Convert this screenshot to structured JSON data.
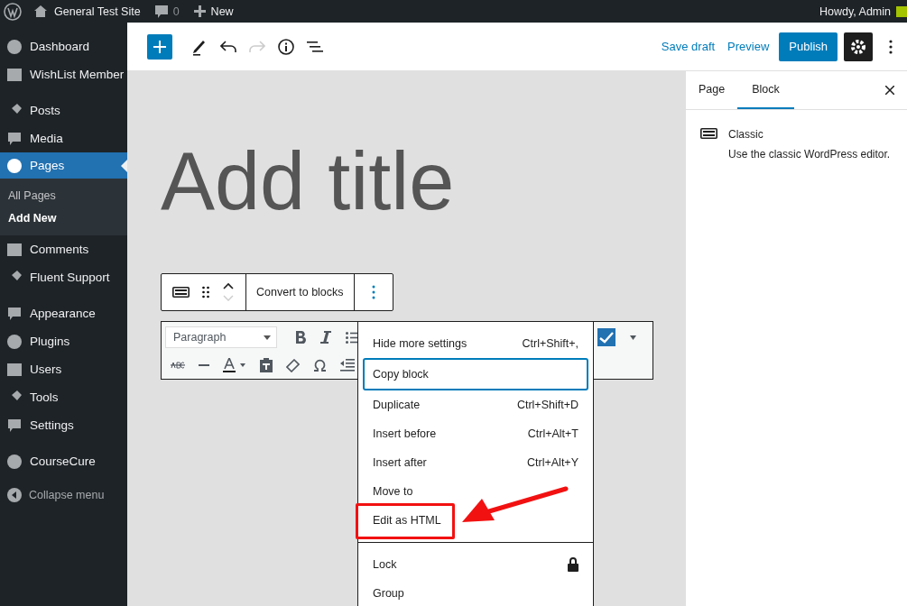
{
  "admin_bar": {
    "site_name": "General Test Site",
    "comments_count": "0",
    "new_label": "New",
    "greeting": "Howdy, Admin"
  },
  "sidebar": {
    "groups": [
      [
        {
          "label": "Dashboard",
          "selected": false
        },
        {
          "label": "WishList Member",
          "selected": false
        }
      ],
      [
        {
          "label": "Posts",
          "selected": false
        },
        {
          "label": "Media",
          "selected": false
        },
        {
          "label": "Pages",
          "selected": true,
          "children": [
            {
              "label": "All Pages",
              "selected": false
            },
            {
              "label": "Add New",
              "selected": true
            }
          ]
        },
        {
          "label": "Comments",
          "selected": false
        },
        {
          "label": "Fluent Support",
          "selected": false
        }
      ],
      [
        {
          "label": "Appearance",
          "selected": false
        },
        {
          "label": "Plugins",
          "selected": false
        },
        {
          "label": "Users",
          "selected": false
        },
        {
          "label": "Tools",
          "selected": false
        },
        {
          "label": "Settings",
          "selected": false
        }
      ],
      [
        {
          "label": "CourseCure",
          "selected": false
        }
      ]
    ],
    "collapse_label": "Collapse menu"
  },
  "header": {
    "undo": {
      "disabled": false
    },
    "redo": {
      "disabled": true
    },
    "save_draft": "Save draft",
    "preview": "Preview",
    "publish": "Publish",
    "settings_active": true
  },
  "editor": {
    "title_placeholder": "Add title",
    "block_toolbar": {
      "convert_label": "Convert to blocks"
    },
    "classic_toolbar": {
      "format": "Paragraph"
    }
  },
  "block_menu": {
    "sections": [
      [
        {
          "kind": "command",
          "label": "Hide more settings",
          "shortcut": "Ctrl+Shift+,",
          "selected": false,
          "annotated": false
        },
        {
          "kind": "command",
          "label": "Copy block",
          "selected": true,
          "annotated": false
        },
        {
          "kind": "command",
          "label": "Duplicate",
          "shortcut": "Ctrl+Shift+D",
          "selected": false,
          "annotated": false
        },
        {
          "kind": "command",
          "label": "Insert before",
          "shortcut": "Ctrl+Alt+T",
          "selected": false,
          "annotated": false
        },
        {
          "kind": "command",
          "label": "Insert after",
          "shortcut": "Ctrl+Alt+Y",
          "selected": false,
          "annotated": false
        },
        {
          "kind": "command",
          "label": "Move to",
          "selected": false,
          "annotated": false
        },
        {
          "kind": "command",
          "label": "Edit as HTML",
          "selected": false,
          "annotated": true
        }
      ],
      [
        {
          "kind": "lock",
          "label": "Lock",
          "selected": false,
          "annotated": false
        },
        {
          "kind": "command",
          "label": "Group",
          "selected": false,
          "annotated": false
        }
      ]
    ]
  },
  "settings_panel": {
    "tabs": [
      {
        "label": "Page",
        "selected": false
      },
      {
        "label": "Block",
        "selected": true
      }
    ],
    "block": {
      "name": "Classic",
      "description": "Use the classic WordPress editor."
    }
  }
}
